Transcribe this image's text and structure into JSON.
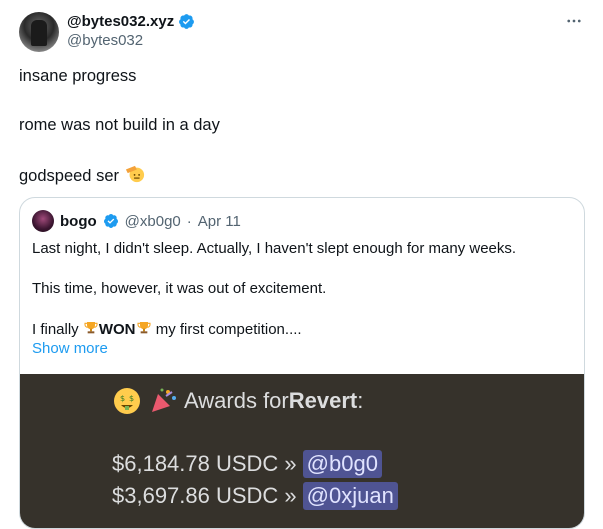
{
  "tweet": {
    "author_name": "@bytes032.xyz",
    "author_handle": "@bytes032",
    "lines": [
      "insane progress",
      "rome was not build in a day",
      "godspeed ser"
    ]
  },
  "quote": {
    "author_name": "bogo",
    "author_handle": "@xb0g0",
    "date": "Apr 11",
    "line1": "Last night, I didn't sleep. Actually, I haven't slept enough for many weeks.",
    "line2": "This time, however, it was out of excitement.",
    "line3_prefix": "I finally ",
    "line3_bold": "WON",
    "line3_suffix": " my first competition....",
    "show_more": "Show more"
  },
  "discord": {
    "title_prefix": "Awards for ",
    "title_bold": "Revert",
    "title_suffix": ":",
    "awards": [
      {
        "amount": "$6,184.78 USDC »",
        "user": "@b0g0"
      },
      {
        "amount": "$3,697.86 USDC »",
        "user": "@0xjuan"
      }
    ]
  },
  "colors": {
    "accent": "#1d9bf0",
    "discord_bg": "#36322b",
    "mention_bg": "#4f5493"
  }
}
